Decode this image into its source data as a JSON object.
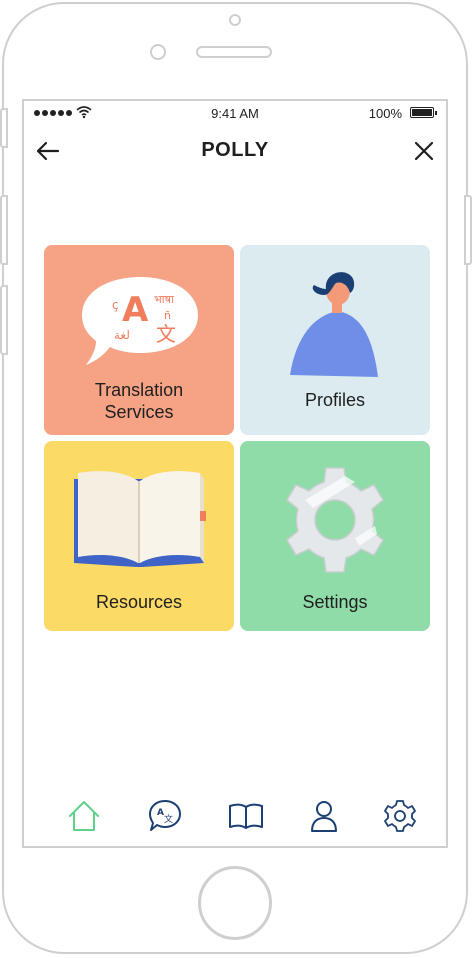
{
  "status_bar": {
    "time": "9:41 AM",
    "battery": "100%"
  },
  "nav": {
    "title": "POLLY"
  },
  "tiles": [
    {
      "label": "Translation\nServices",
      "color": "#f5a384"
    },
    {
      "label": "Profiles",
      "color": "#dcebf0"
    },
    {
      "label": "Resources",
      "color": "#fcda66"
    },
    {
      "label": "Settings",
      "color": "#90dca9"
    }
  ],
  "translation_glyphs": {
    "big": "A",
    "cedilla": "ç",
    "hindi": "भाषा",
    "tilde": "ñ",
    "arabic": "لغة",
    "chinese": "文"
  },
  "icons": {
    "back": "arrow-left-icon",
    "close": "close-icon",
    "tabs": [
      "home-icon",
      "translate-icon",
      "book-icon",
      "user-icon",
      "gear-icon"
    ]
  },
  "colors": {
    "active_tab": "#5fd18b",
    "inactive_tab": "#1c3f73"
  }
}
